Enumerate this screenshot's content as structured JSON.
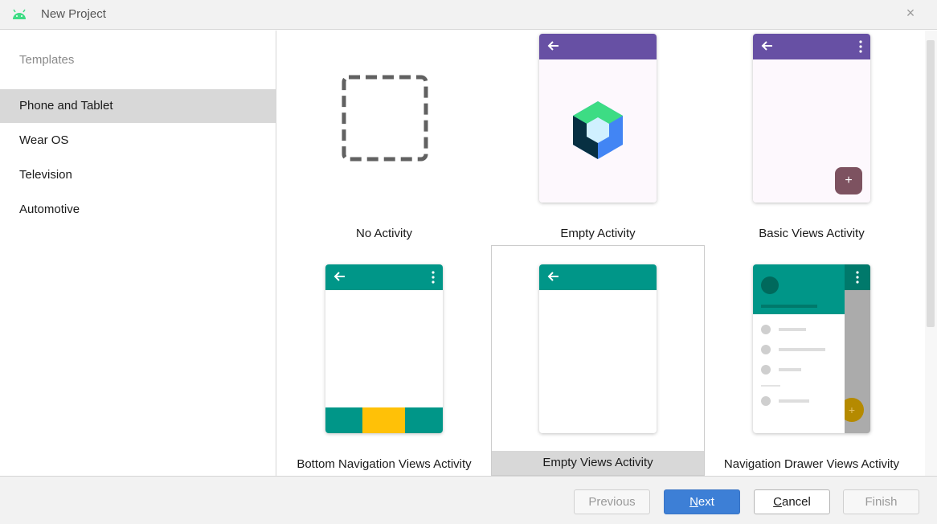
{
  "window": {
    "title": "New Project",
    "close_icon": "close-icon"
  },
  "colors": {
    "android_green": "#3ddc84",
    "purple_bar": "#6750a4",
    "teal_bar": "#009688",
    "fab_maroon": "#7d5260",
    "amber": "#ffc107",
    "primary_button": "#3d7fd6"
  },
  "sidebar": {
    "heading": "Templates",
    "items": [
      {
        "label": "Phone and Tablet",
        "selected": true
      },
      {
        "label": "Wear OS",
        "selected": false
      },
      {
        "label": "Television",
        "selected": false
      },
      {
        "label": "Automotive",
        "selected": false
      }
    ]
  },
  "templates": [
    {
      "label": "No Activity",
      "icon": "dashed-square-icon",
      "selected": false
    },
    {
      "label": "Empty Activity",
      "icon": "compose-logo-icon",
      "selected": false
    },
    {
      "label": "Basic Views Activity",
      "icon": "fab-plus-icon",
      "selected": false
    },
    {
      "label": "Bottom Navigation Views Activity",
      "icon": "bottom-nav-icon",
      "selected": false
    },
    {
      "label": "Empty Views Activity",
      "icon": "empty-phone-icon",
      "selected": true
    },
    {
      "label": "Navigation Drawer Views Activity",
      "icon": "nav-drawer-icon",
      "selected": false
    }
  ],
  "footer": {
    "previous": {
      "label": "Previous",
      "enabled": false
    },
    "next": {
      "label": "Next",
      "mnemonic": "N",
      "rest": "ext",
      "enabled": true
    },
    "cancel": {
      "label": "Cancel",
      "mnemonic": "C",
      "rest": "ancel",
      "enabled": true
    },
    "finish": {
      "label": "Finish",
      "enabled": false
    }
  }
}
